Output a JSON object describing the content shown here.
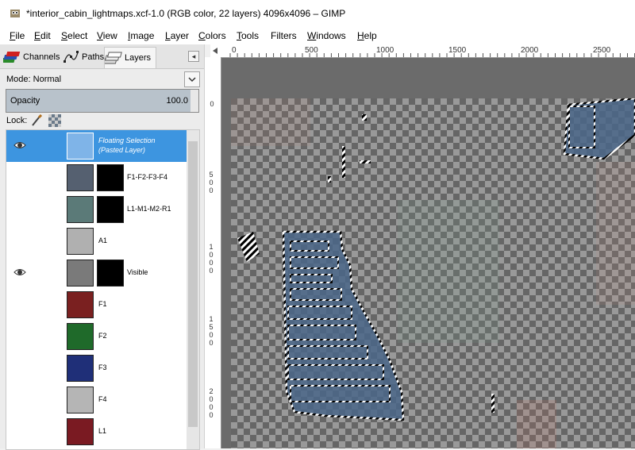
{
  "window": {
    "title": "*interior_cabin_lightmaps.xcf-1.0 (RGB color, 22 layers) 4096x4096 – GIMP"
  },
  "menubar": {
    "items": [
      {
        "key": "file",
        "underline": "F",
        "rest": "ile"
      },
      {
        "key": "edit",
        "underline": "E",
        "rest": "dit"
      },
      {
        "key": "select",
        "underline": "S",
        "rest": "elect"
      },
      {
        "key": "view",
        "underline": "V",
        "rest": "iew"
      },
      {
        "key": "image",
        "underline": "I",
        "rest": "mage"
      },
      {
        "key": "layer",
        "underline": "L",
        "rest": "ayer"
      },
      {
        "key": "colors",
        "underline": "C",
        "rest": "olors"
      },
      {
        "key": "tools",
        "underline": "T",
        "rest": "ools"
      },
      {
        "key": "filters",
        "underline": "",
        "rest": "Filters"
      },
      {
        "key": "windows",
        "underline": "W",
        "rest": "indows"
      },
      {
        "key": "help",
        "underline": "H",
        "rest": "elp"
      }
    ]
  },
  "dock": {
    "tabs": [
      {
        "label": "Channels",
        "icon": "channels-icon"
      },
      {
        "label": "Paths",
        "icon": "paths-icon"
      },
      {
        "label": "Layers",
        "icon": "layers-icon"
      }
    ],
    "mode_label": "Mode: Normal",
    "opacity_label": "Opacity",
    "opacity_value": "100.0",
    "lock_label": "Lock:",
    "layers": [
      {
        "name_line1": "Floating Selection",
        "name_line2": "(Pasted Layer)",
        "visible": true,
        "selected": true,
        "mask": false,
        "thumb_color": "#7fb4e8"
      },
      {
        "name": "F1-F2-F3-F4",
        "visible": false,
        "selected": false,
        "mask": true,
        "thumb_color": "#556070"
      },
      {
        "name": "L1-M1-M2-R1",
        "visible": false,
        "selected": false,
        "mask": true,
        "thumb_color": "#5b7a78"
      },
      {
        "name": "A1",
        "visible": false,
        "selected": false,
        "mask": false,
        "thumb_color": "#b0b0b0"
      },
      {
        "name": "Visible",
        "visible": true,
        "selected": false,
        "mask": true,
        "thumb_color": "#7a7a7a"
      },
      {
        "name": "F1",
        "visible": false,
        "selected": false,
        "mask": false,
        "thumb_color": "#7a2020"
      },
      {
        "name": "F2",
        "visible": false,
        "selected": false,
        "mask": false,
        "thumb_color": "#1f6a2a"
      },
      {
        "name": "F3",
        "visible": false,
        "selected": false,
        "mask": false,
        "thumb_color": "#1f2f78"
      },
      {
        "name": "F4",
        "visible": false,
        "selected": false,
        "mask": false,
        "thumb_color": "#b5b5b5"
      },
      {
        "name": "L1",
        "visible": false,
        "selected": false,
        "mask": false,
        "thumb_color": "#7a1a22"
      }
    ]
  },
  "rulers": {
    "top": [
      "0",
      "500",
      "1000",
      "1500",
      "2000",
      "2500"
    ],
    "left": [
      "0",
      "500",
      "1000",
      "1500",
      "2000"
    ]
  },
  "colors": {
    "selection": "#3d95e0",
    "canvas_blue": "#4a6688"
  }
}
